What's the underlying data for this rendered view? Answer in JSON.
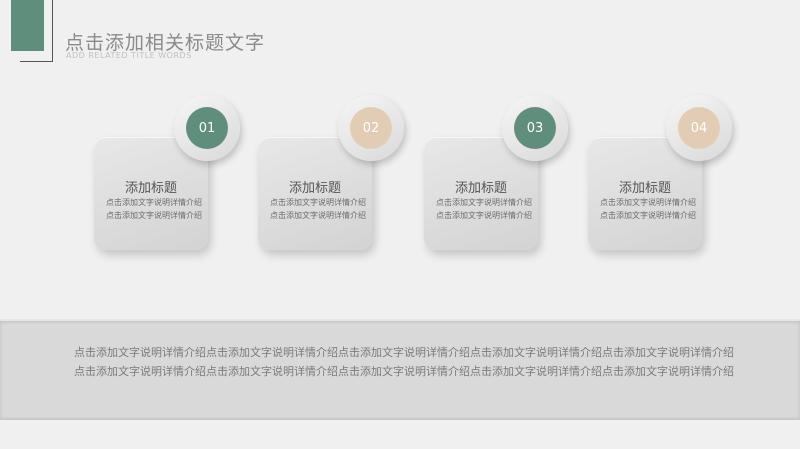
{
  "header": {
    "title": "点击添加相关标题文字",
    "subtitle": "ADD RELATED TITLE WORDS"
  },
  "cards": [
    {
      "number": "01",
      "title": "添加标题",
      "desc": "点击添加文字说明详情介绍点击添加文字说明详情介绍"
    },
    {
      "number": "02",
      "title": "添加标题",
      "desc": "点击添加文字说明详情介绍点击添加文字说明详情介绍"
    },
    {
      "number": "03",
      "title": "添加标题",
      "desc": "点击添加文字说明详情介绍点击添加文字说明详情介绍"
    },
    {
      "number": "04",
      "title": "添加标题",
      "desc": "点击添加文字说明详情介绍点击添加文字说明详情介绍"
    }
  ],
  "panel": {
    "text": "点击添加文字说明详情介绍点击添加文字说明详情介绍点击添加文字说明详情介绍点击添加文字说明详情介绍点击添加文字说明详情介绍点击添加文字说明详情介绍点击添加文字说明详情介绍点击添加文字说明详情介绍点击添加文字说明详情介绍点击添加文字说明详情介绍"
  },
  "colors": {
    "accent_green": "#5f8f7c",
    "accent_tan": "#e2cdb4",
    "background": "#f0f0f0"
  }
}
